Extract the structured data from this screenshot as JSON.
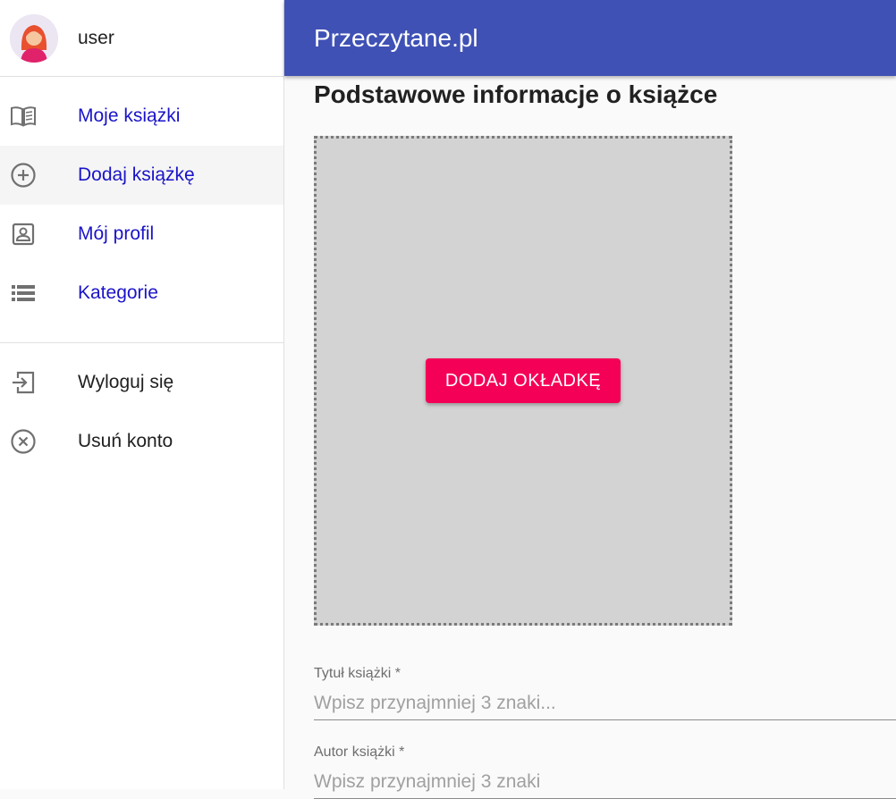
{
  "app": {
    "title": "Przeczytane.pl"
  },
  "user": {
    "name": "user"
  },
  "sidebar": {
    "items": [
      {
        "label": "Moje książki",
        "icon": "book-open-icon"
      },
      {
        "label": "Dodaj książkę",
        "icon": "add-circle-icon",
        "active": true
      },
      {
        "label": "Mój profil",
        "icon": "profile-icon"
      },
      {
        "label": "Kategorie",
        "icon": "list-icon"
      }
    ],
    "secondary": [
      {
        "label": "Wyloguj się",
        "icon": "logout-icon"
      },
      {
        "label": "Usuń konto",
        "icon": "cancel-circle-icon"
      }
    ]
  },
  "main": {
    "section_title": "Podstawowe informacje o książce",
    "cover_button": "DODAJ OKŁADKĘ",
    "fields": [
      {
        "label": "Tytuł książki *",
        "placeholder": "Wpisz przynajmniej 3 znaki..."
      },
      {
        "label": "Autor książki *",
        "placeholder": "Wpisz przynajmniej 3 znaki"
      }
    ]
  },
  "colors": {
    "appbar": "#3f51b5",
    "accent": "#f50057",
    "link": "#1a14c8",
    "cover_bg": "#d3d3d3"
  }
}
